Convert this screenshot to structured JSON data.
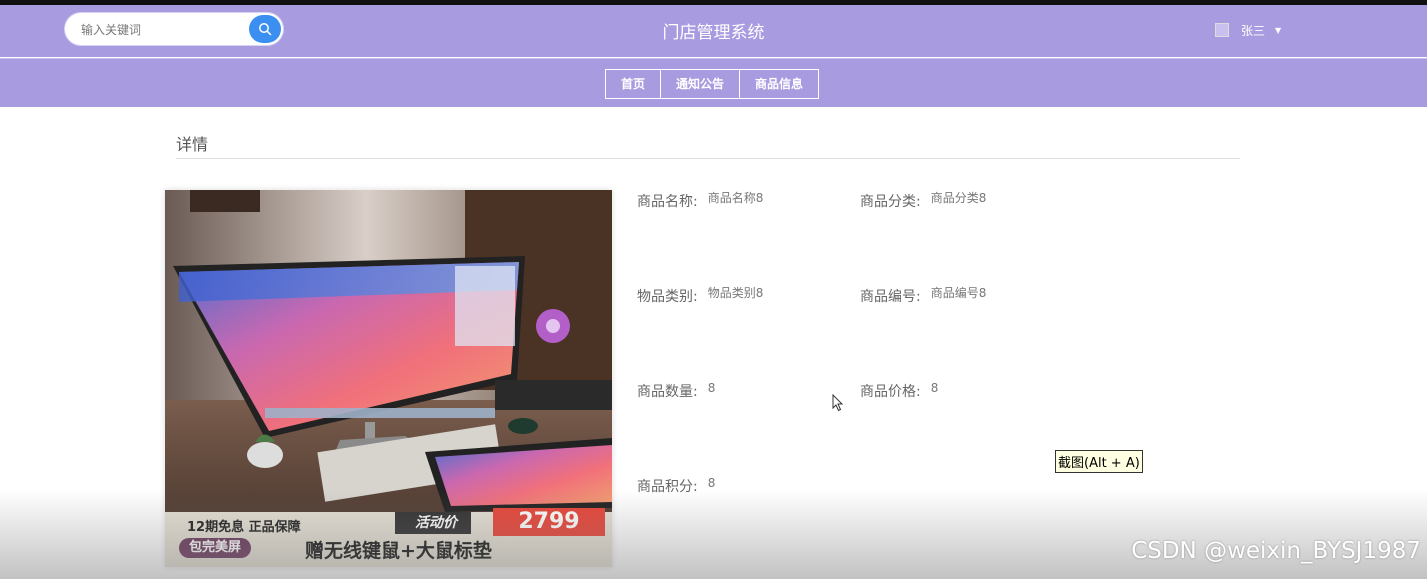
{
  "header": {
    "search": {
      "placeholder": "输入关键词"
    },
    "title": "门店管理系统",
    "user": {
      "name": "张三"
    }
  },
  "nav": {
    "items": [
      "首页",
      "通知公告",
      "商品信息"
    ]
  },
  "detail": {
    "section_title": "详情",
    "image_texts": {
      "installment": "12期免息 正品保障",
      "promo_label": "活动价",
      "price": "2799",
      "badge": "包完美屏",
      "gift": "赠无线键鼠+大鼠标垫"
    },
    "fields": [
      {
        "label": "商品名称:",
        "value": "商品名称8"
      },
      {
        "label": "商品分类:",
        "value": "商品分类8"
      },
      {
        "label": "物品类别:",
        "value": "物品类别8"
      },
      {
        "label": "商品编号:",
        "value": "商品编号8"
      },
      {
        "label": "商品数量:",
        "value": "8"
      },
      {
        "label": "商品价格:",
        "value": "8"
      },
      {
        "label": "商品积分:",
        "value": "8"
      }
    ]
  },
  "tooltip": "截图(Alt + A)",
  "watermark": "CSDN @weixin_BYSJ1987",
  "colors": {
    "header_bg": "#a99be0",
    "search_button": "#3b8ff0",
    "price_red": "#e8463a"
  }
}
